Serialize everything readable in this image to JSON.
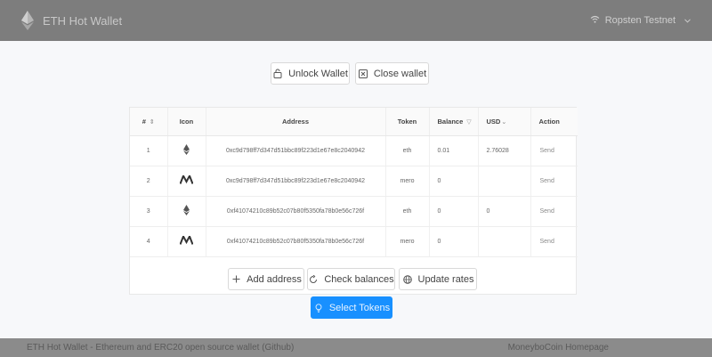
{
  "header": {
    "app_title": "ETH Hot Wallet",
    "network_label": "Ropsten Testnet"
  },
  "wallet_actions": {
    "unlock_label": "Unlock Wallet",
    "close_label": "Close wallet"
  },
  "table": {
    "columns": [
      "#",
      "Icon",
      "Address",
      "Token",
      "Balance",
      "USD",
      "Action"
    ],
    "rows": [
      {
        "index": "1",
        "icon": "eth-icon",
        "address": "0xc9d798ff7d347d51bbc89f223d1e67e8c2040942",
        "token": "eth",
        "balance": "0.01",
        "usd": "2.76028",
        "action": "Send"
      },
      {
        "index": "2",
        "icon": "mero-icon",
        "address": "0xc9d798ff7d347d51bbc89f223d1e67e8c2040942",
        "token": "mero",
        "balance": "0",
        "usd": "",
        "action": "Send"
      },
      {
        "index": "3",
        "icon": "eth-icon",
        "address": "0xf41074210c89b52c07b80f5350fa78b0e56c726f",
        "token": "eth",
        "balance": "0",
        "usd": "0",
        "action": "Send"
      },
      {
        "index": "4",
        "icon": "mero-icon",
        "address": "0xf41074210c89b52c07b80f5350fa78b0e56c726f",
        "token": "mero",
        "balance": "0",
        "usd": "",
        "action": "Send"
      }
    ]
  },
  "table_actions": {
    "add_address_label": "Add address",
    "check_balances_label": "Check balances",
    "update_rates_label": "Update rates",
    "select_tokens_label": "Select Tokens"
  },
  "footer": {
    "left_text": "ETH Hot Wallet - Ethereum and ERC20 open source wallet (Github)",
    "right_text": "MoneyboCoin Homepage"
  },
  "colors": {
    "primary": "#1890ff",
    "header_bg": "#7d7d7d",
    "footer_bg": "#8b8b8b"
  }
}
